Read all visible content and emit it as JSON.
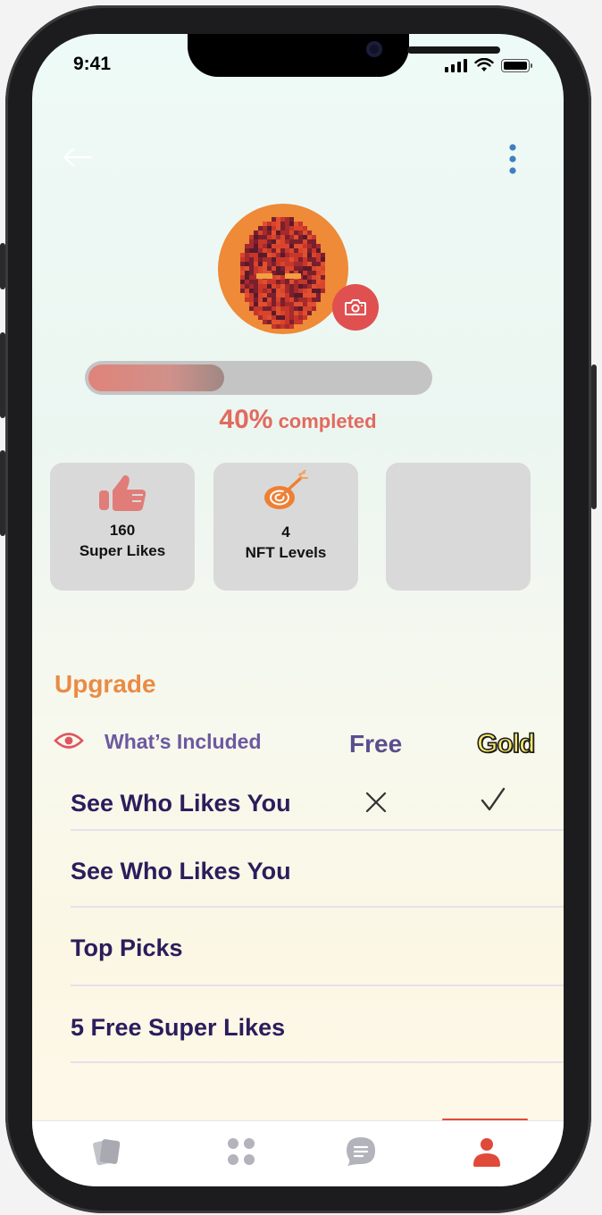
{
  "status_bar": {
    "time": "9:41"
  },
  "profile": {
    "progress": {
      "percent": 40,
      "percent_text": "40%",
      "completed_text": " completed"
    },
    "stats": [
      {
        "value": "160",
        "label": "Super Likes",
        "icon": "thumbs-up-icon"
      },
      {
        "value": "4",
        "label": "NFT Levels",
        "icon": "target-dart-icon"
      },
      {
        "value": "",
        "label": "",
        "icon": ""
      }
    ]
  },
  "upgrade": {
    "title": "Upgrade",
    "included_label": "What’s Included",
    "plans": {
      "free": "Free",
      "gold": "Gold"
    },
    "features": [
      {
        "label": "See Who Likes You",
        "free": "no",
        "gold": "yes"
      },
      {
        "label": "See Who Likes You"
      },
      {
        "label": "Top Picks"
      },
      {
        "label": "5 Free Super Likes"
      }
    ]
  },
  "tabbar": {
    "items": [
      {
        "name": "cards",
        "icon": "cards-icon"
      },
      {
        "name": "discover",
        "icon": "grid-dots-icon"
      },
      {
        "name": "chat",
        "icon": "chat-bubble-icon"
      },
      {
        "name": "profile",
        "icon": "profile-icon",
        "active": true
      }
    ]
  },
  "colors": {
    "accent": "#e05050",
    "upgrade_orange": "#ea8b45",
    "feature_text": "#2b1d5c",
    "included_purple": "#6b5aa0",
    "gold_fill": "#f5e86a"
  }
}
